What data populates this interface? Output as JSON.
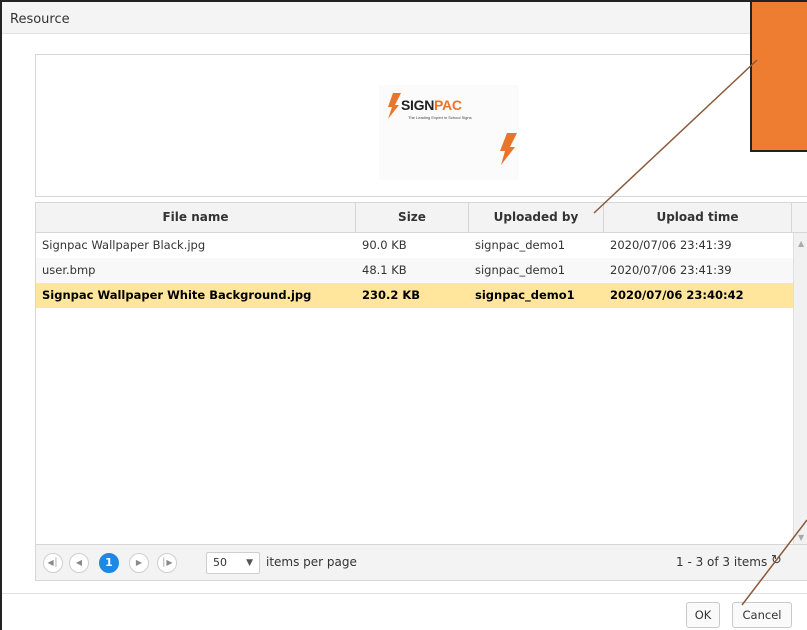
{
  "window": {
    "title": "Resource"
  },
  "preview": {
    "logo": {
      "brand_dark": "SIGN",
      "brand_accent": "PAC",
      "tagline": "The Leading Expert in School Signs",
      "accent_color": "#e8752a"
    }
  },
  "grid": {
    "columns": [
      "File name",
      "Size",
      "Uploaded by",
      "Upload time"
    ],
    "rows": [
      {
        "name": "Signpac Wallpaper Black.jpg",
        "size": "90.0 KB",
        "uploaded_by": "signpac_demo1",
        "time": "2020/07/06 23:41:39",
        "selected": false
      },
      {
        "name": "user.bmp",
        "size": "48.1 KB",
        "uploaded_by": "signpac_demo1",
        "time": "2020/07/06 23:41:39",
        "selected": false
      },
      {
        "name": "Signpac Wallpaper White Background.jpg",
        "size": "230.2 KB",
        "uploaded_by": "signpac_demo1",
        "time": "2020/07/06 23:40:42",
        "selected": true
      }
    ],
    "selected_row_color": "#ffe69c"
  },
  "pager": {
    "current_page": "1",
    "page_size": "50",
    "items_per_page_label": "items per page",
    "count_text": "1 - 3 of 3 items",
    "icons": {
      "first": "first-page-icon",
      "prev": "prev-page-icon",
      "next": "next-page-icon",
      "last": "last-page-icon",
      "refresh": "refresh-icon"
    },
    "active_color": "#1e88e5"
  },
  "footer": {
    "ok_label": "OK",
    "cancel_label": "Cancel"
  },
  "annotation": {
    "callout_color": "#ee7d31"
  }
}
